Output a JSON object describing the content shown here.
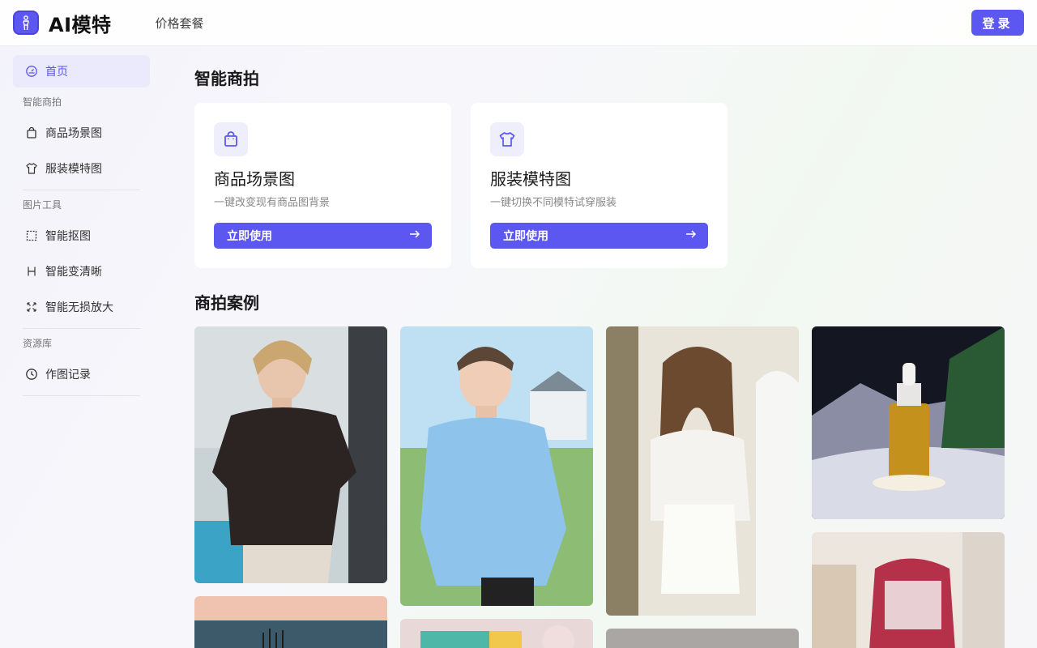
{
  "header": {
    "brand": "AI模特",
    "nav_pricing": "价格套餐",
    "login_label": "登录"
  },
  "sidebar": {
    "home": "首页",
    "group_smart_shoot": "智能商拍",
    "product_scene": "商品场景图",
    "clothing_model": "服装模特图",
    "group_image_tools": "图片工具",
    "smart_cutout": "智能抠图",
    "smart_sharpen": "智能变清晰",
    "smart_upscale": "智能无损放大",
    "group_resources": "资源库",
    "history": "作图记录"
  },
  "main": {
    "section_title": "智能商拍",
    "cards": [
      {
        "title": "商品场景图",
        "desc": "一键改变现有商品图背景",
        "button": "立即使用"
      },
      {
        "title": "服装模特图",
        "desc": "一键切换不同模特试穿服装",
        "button": "立即使用"
      }
    ],
    "cases_title": "商拍案例"
  },
  "colors": {
    "accent": "#5b57f0",
    "accent_light": "#ebeafc"
  },
  "icons": {
    "logo": "person-silhouette-icon",
    "home": "dashboard-icon",
    "product_scene": "shopping-bag-icon",
    "clothing_model": "shirt-icon",
    "smart_cutout": "selection-icon",
    "smart_sharpen": "h-icon",
    "smart_upscale": "expand-icon",
    "history": "clock-icon",
    "button_arrow": "arrow-right-icon"
  }
}
